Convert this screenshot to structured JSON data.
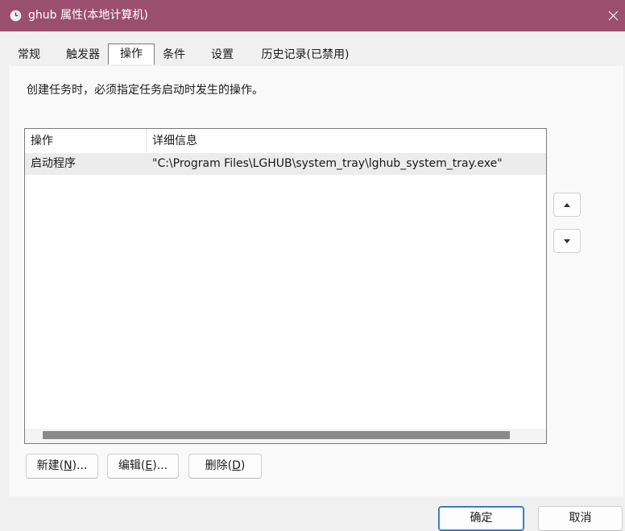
{
  "window": {
    "title": "ghub 属性(本地计算机)",
    "title_bar_color": "#9b4f6f",
    "icon": "clock-icon",
    "close_icon": "close-icon"
  },
  "tabs": [
    {
      "label": "常规",
      "active": false
    },
    {
      "label": "触发器",
      "active": false
    },
    {
      "label": "操作",
      "active": true
    },
    {
      "label": "条件",
      "active": false
    },
    {
      "label": "设置",
      "active": false
    },
    {
      "label": "历史记录(已禁用)",
      "active": false
    }
  ],
  "description": "创建任务时，必须指定任务启动时发生的操作。",
  "actions_table": {
    "columns": [
      "操作",
      "详细信息"
    ],
    "rows": [
      {
        "action": "启动程序",
        "details": "\"C:\\Program Files\\LGHUB\\system_tray\\lghub_system_tray.exe\""
      }
    ]
  },
  "side_buttons": {
    "move_up_icon": "triangle-up-icon",
    "move_down_icon": "triangle-down-icon"
  },
  "action_buttons": {
    "new": {
      "label": "新建(",
      "key": "N",
      "suffix": ")..."
    },
    "edit": {
      "label": "编辑(",
      "key": "E",
      "suffix": ")..."
    },
    "delete": {
      "label": "删除(",
      "key": "D",
      "suffix": ")"
    }
  },
  "dialog_buttons": {
    "ok": "确定",
    "cancel": "取消"
  }
}
